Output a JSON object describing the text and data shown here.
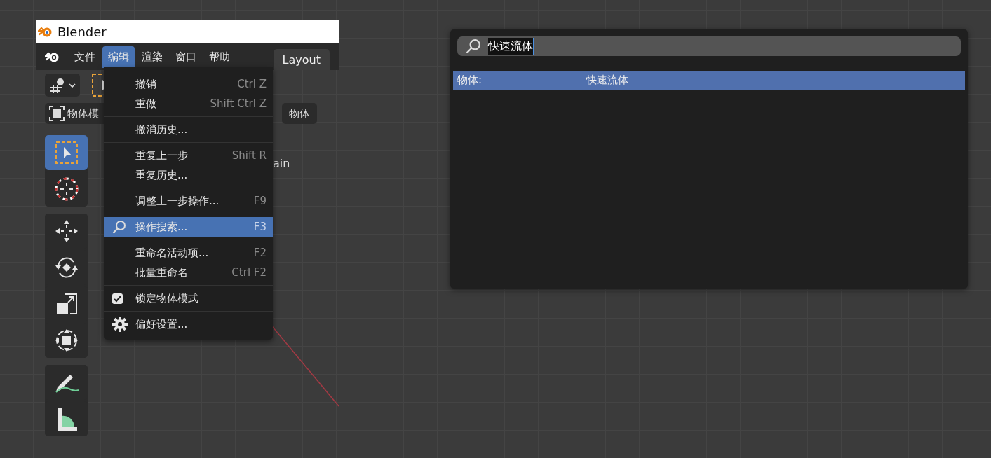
{
  "window": {
    "title": "Blender"
  },
  "menubar": {
    "items": [
      {
        "label": "文件",
        "selected": false
      },
      {
        "label": "编辑",
        "selected": true
      },
      {
        "label": "渲染",
        "selected": false
      },
      {
        "label": "窗口",
        "selected": false
      },
      {
        "label": "帮助",
        "selected": false
      }
    ],
    "workspace_tab": {
      "label": "Layout",
      "selected": true
    }
  },
  "header": {
    "mode_dropdown": "物体模",
    "object_menu": "物体"
  },
  "viewport": {
    "overlay_text": "ain"
  },
  "toolbar": {
    "groups": [
      [
        {
          "kind": "select",
          "selected": true
        },
        {
          "kind": "cursor",
          "selected": false
        }
      ],
      [
        {
          "kind": "move",
          "selected": false
        },
        {
          "kind": "rotate",
          "selected": false
        },
        {
          "kind": "scale",
          "selected": false
        },
        {
          "kind": "transform",
          "selected": false
        }
      ],
      [
        {
          "kind": "annotate",
          "selected": false
        },
        {
          "kind": "measure",
          "selected": false
        }
      ]
    ]
  },
  "edit_menu": {
    "groups": [
      [
        {
          "kind": "plain",
          "label": "撤销",
          "shortcut": "Ctrl Z",
          "selected": false
        },
        {
          "kind": "plain",
          "label": "重做",
          "shortcut": "Shift Ctrl Z",
          "selected": false
        }
      ],
      [
        {
          "kind": "plain",
          "label": "撤消历史...",
          "selected": false
        }
      ],
      [
        {
          "kind": "plain",
          "label": "重复上一步",
          "shortcut": "Shift R",
          "selected": false
        },
        {
          "kind": "plain",
          "label": "重复历史...",
          "selected": false
        }
      ],
      [
        {
          "kind": "plain",
          "label": "调整上一步操作...",
          "shortcut": "F9",
          "selected": false
        }
      ],
      [
        {
          "kind": "search",
          "label": "操作搜索...",
          "shortcut": "F3",
          "selected": true
        }
      ],
      [
        {
          "kind": "plain",
          "label": "重命名活动项...",
          "shortcut": "F2",
          "selected": false
        },
        {
          "kind": "plain",
          "label": "批量重命名",
          "shortcut": "Ctrl F2",
          "selected": false
        }
      ],
      [
        {
          "kind": "checkbox",
          "label": "锁定物体模式",
          "checked": true,
          "selected": false
        }
      ],
      [
        {
          "kind": "gear",
          "label": "偏好设置...",
          "selected": false
        }
      ]
    ]
  },
  "search_popup": {
    "query": "快速流体",
    "results": [
      {
        "category": "物体:",
        "name": "快速流体",
        "selected": true
      }
    ]
  }
}
